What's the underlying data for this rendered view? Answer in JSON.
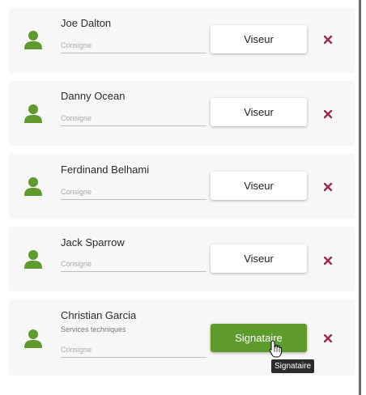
{
  "signers": [
    {
      "name": "Joe Dalton",
      "subtitle": "",
      "consigne_placeholder": "Consigne",
      "role_label": "Viseur",
      "role_active": false
    },
    {
      "name": "Danny Ocean",
      "subtitle": "",
      "consigne_placeholder": "Consigne",
      "role_label": "Viseur",
      "role_active": false
    },
    {
      "name": "Ferdinand Belhami",
      "subtitle": "",
      "consigne_placeholder": "Consigne",
      "role_label": "Viseur",
      "role_active": false
    },
    {
      "name": "Jack Sparrow",
      "subtitle": "",
      "consigne_placeholder": "Consigne",
      "role_label": "Viseur",
      "role_active": false
    },
    {
      "name": "Christian Garcia",
      "subtitle": "Services techniques",
      "consigne_placeholder": "Consigne",
      "role_label": "Signataire",
      "role_active": true
    }
  ],
  "tooltip": {
    "text": "Signataire"
  },
  "icons": {
    "avatar": "person-icon",
    "remove": "close-icon",
    "cursor": "hand-pointer-icon"
  },
  "colors": {
    "accent_green": "#5f9a2d",
    "remove_red": "#9b2c4a",
    "card_bg": "#f7f7f7"
  }
}
